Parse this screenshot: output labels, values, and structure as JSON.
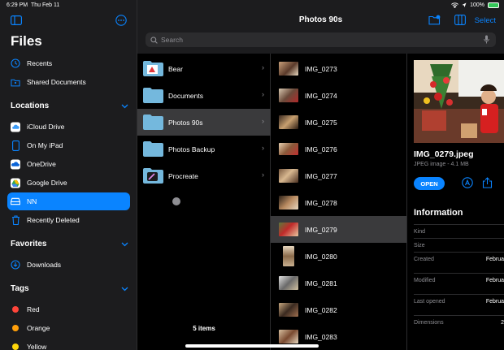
{
  "status": {
    "time": "6:29 PM",
    "date": "Thu Feb 11",
    "battery": "100%"
  },
  "sidebar": {
    "title": "Files",
    "top_items": [
      {
        "label": "Recents"
      },
      {
        "label": "Shared Documents"
      }
    ],
    "locations": {
      "header": "Locations",
      "items": [
        {
          "label": "iCloud Drive"
        },
        {
          "label": "On My iPad"
        },
        {
          "label": "OneDrive"
        },
        {
          "label": "Google Drive"
        },
        {
          "label": "NN"
        },
        {
          "label": "Recently Deleted"
        }
      ]
    },
    "favorites": {
      "header": "Favorites",
      "items": [
        {
          "label": "Downloads"
        }
      ]
    },
    "tags": {
      "header": "Tags",
      "items": [
        {
          "label": "Red",
          "color": "#ff453a"
        },
        {
          "label": "Orange",
          "color": "#ff9f0a"
        },
        {
          "label": "Yellow",
          "color": "#ffd60a"
        }
      ]
    }
  },
  "header": {
    "title": "Photos 90s",
    "select_label": "Select",
    "search_placeholder": "Search"
  },
  "folders": {
    "items": [
      {
        "label": "Bear"
      },
      {
        "label": "Documents"
      },
      {
        "label": "Photos 90s"
      },
      {
        "label": "Photos Backup"
      },
      {
        "label": "Procreate"
      }
    ],
    "count_label": "5 items"
  },
  "files": [
    {
      "label": "IMG_0273"
    },
    {
      "label": "IMG_0274"
    },
    {
      "label": "IMG_0275"
    },
    {
      "label": "IMG_0276"
    },
    {
      "label": "IMG_0277"
    },
    {
      "label": "IMG_0278"
    },
    {
      "label": "IMG_0279"
    },
    {
      "label": "IMG_0280"
    },
    {
      "label": "IMG_0281"
    },
    {
      "label": "IMG_0282"
    },
    {
      "label": "IMG_0283"
    }
  ],
  "inspector": {
    "filename": "IMG_0279.jpeg",
    "fileinfo": "JPEG image - 4.1 MB",
    "open_label": "OPEN",
    "info_header": "Information",
    "rows": [
      {
        "label": "Kind",
        "value": ""
      },
      {
        "label": "Size",
        "value": ""
      },
      {
        "label": "Created",
        "value": "Februa"
      },
      {
        "label": "Modified",
        "value": "Februa"
      },
      {
        "label": "Last opened",
        "value": "Februa"
      },
      {
        "label": "Dimensions",
        "value": "2"
      }
    ]
  },
  "colors": {
    "accent": "#0a84ff",
    "sidebar_bg": "#1c1c1e",
    "selected_row": "#3a3a3c",
    "folder": "#74b8dd"
  }
}
